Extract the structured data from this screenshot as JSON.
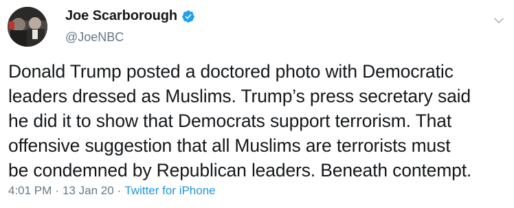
{
  "tweet": {
    "author": {
      "display_name": "Joe Scarborough",
      "handle": "@JoeNBC",
      "verified": true,
      "avatar_icon": "profile-photo"
    },
    "text": "Donald Trump posted a doctored photo with Democratic\nleaders dressed as Muslims. Trump’s press secretary said\nhe did it to show that Democrats support terrorism. That\noffensive suggestion that all Muslims are terrorists must\nbe condemned by Republican leaders. Beneath contempt.",
    "time": "4:01 PM",
    "date": "13 Jan 20",
    "separator": "·",
    "source": "Twitter for iPhone",
    "menu_icon": "chevron-down-icon"
  },
  "colors": {
    "name": "#14171a",
    "secondary": "#657786",
    "link": "#1b95e0",
    "verified": "#1da1f2",
    "chevron": "#aab8c2"
  }
}
